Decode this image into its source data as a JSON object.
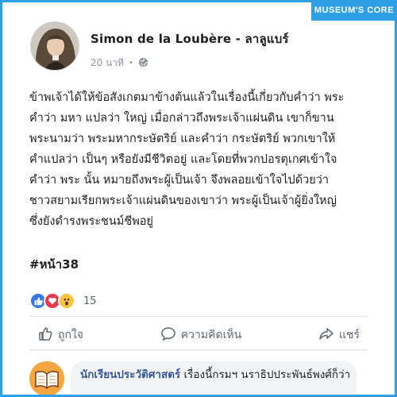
{
  "badge": {
    "label": "MUSEUM'S CORE"
  },
  "post": {
    "author": "Simon de la Loubère - ลาลูแบร์",
    "time": "20 นาที",
    "text_lines": [
      "ข้าพเจ้าได้ให้ข้อสังเกตมาข้างต้นแล้วในเรื่องนี้เกี่ยวกับคำว่า พระ",
      "คำว่า มหา แปลว่า ใหญ่ เมื่อกล่าวถึงพระเจ้าแผ่นดิน เขาก็ขาน",
      "พระนามว่า พระมหากระษัตริย์ และคำว่า กระษัตริย์ พวกเขาให้",
      "คำแปลว่า เป็นๆ หรือยังมีชีวิตอยู่ และโดยที่พวกปอรตุเกศเข้าใจ",
      "คำว่า พระ นั้น หมายถึงพระผู้เป็นเจ้า จึงพลอยเข้าใจไปด้วยว่า",
      "ชาวสยามเรียกพระเจ้าแผ่นดินของเขาว่า พระผู้เป็นเจ้าผู้ยิ่งใหญ่",
      "ซึ่งยังดำรงพระชนม์ชีพอยู่"
    ],
    "hashtag": "#หน้า38",
    "reaction_count": "15",
    "reaction_icons": [
      "like-icon",
      "love-icon",
      "wow-icon"
    ],
    "colors": {
      "like": "#3578e5",
      "love": "#e8384f",
      "wow": "#f7c43f",
      "frame": "#2f9fe6"
    }
  },
  "actions": {
    "like": "ถูกใจ",
    "comment": "ความคิดเห็น",
    "share": "แชร์"
  },
  "comment": {
    "name": "นักเรียนประวัติศาสตร์",
    "text": "เรื่องนี้กรมฯ นราธิปประพันธ์พงศ์ก็ว่า"
  }
}
